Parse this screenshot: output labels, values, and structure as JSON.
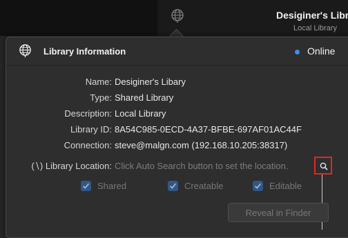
{
  "background_window": {
    "title": "Desiginer's Library",
    "subtitle": "Local Library"
  },
  "popover": {
    "title": "Library Information",
    "status": {
      "label": "Online",
      "color": "#3b8ee8"
    },
    "fields": [
      {
        "label": "Name:",
        "value": "Desiginer's Libary"
      },
      {
        "label": "Type:",
        "value": "Shared Library"
      },
      {
        "label": "Description:",
        "value": "Local Library"
      },
      {
        "label": "Library ID:",
        "value": "8A54C985-0ECD-4A37-BFBE-697AF01AC44F"
      },
      {
        "label": "Connection:",
        "value": "steve@malgn.com (192.168.10.205:38317)"
      },
      {
        "label": "(∖) Library Location:",
        "value": "Click Auto Search button to set the location."
      }
    ],
    "options": [
      {
        "label": "Shared",
        "checked": true
      },
      {
        "label": "Creatable",
        "checked": true
      },
      {
        "label": "Editable",
        "checked": true
      }
    ],
    "reveal_button": "Reveal in Finder",
    "search_button_icon": "magnifier-icon",
    "highlight_color": "#e0281f"
  }
}
